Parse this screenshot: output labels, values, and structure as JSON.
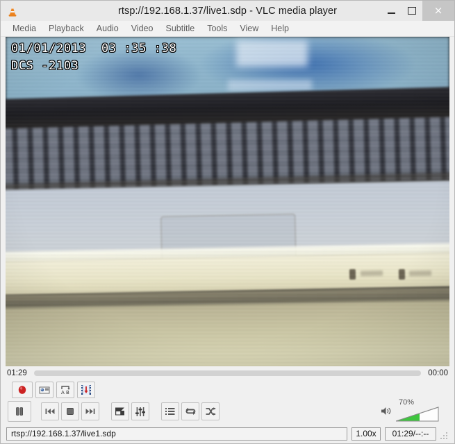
{
  "window": {
    "title": "rtsp://192.168.1.37/live1.sdp - VLC media player",
    "app_icon": "vlc-cone-icon",
    "minimize_label": "",
    "maximize_label": "",
    "close_label": "×"
  },
  "menubar": {
    "items": [
      {
        "label": "Media"
      },
      {
        "label": "Playback"
      },
      {
        "label": "Audio"
      },
      {
        "label": "Video"
      },
      {
        "label": "Subtitle"
      },
      {
        "label": "Tools"
      },
      {
        "label": "View"
      },
      {
        "label": "Help"
      }
    ]
  },
  "video": {
    "osd_line1": "01/01/2013  03 :35 :38",
    "osd_line2": "DCS -2103",
    "description": "blurry webcam view of a laptop keyboard and palm rest"
  },
  "seek": {
    "elapsed": "01:29",
    "remaining": "00:00",
    "progress_percent": 0
  },
  "extended_toolbar": {
    "buttons": [
      {
        "name": "record-button",
        "icon": "record-icon",
        "label": "Record"
      },
      {
        "name": "snapshot-button",
        "icon": "camera-icon",
        "label": "Take snapshot"
      },
      {
        "name": "ab-loop-button",
        "icon": "ab-loop-icon",
        "label": "Loop from A to B"
      },
      {
        "name": "frame-by-frame-button",
        "icon": "film-frame-icon",
        "label": "Frame by frame"
      }
    ]
  },
  "controls": {
    "buttons": [
      {
        "name": "play-pause-button",
        "icon": "pause-icon",
        "label": "Pause"
      },
      {
        "name": "previous-button",
        "icon": "previous-icon",
        "label": "Previous"
      },
      {
        "name": "stop-button",
        "icon": "stop-icon",
        "label": "Stop"
      },
      {
        "name": "next-button",
        "icon": "next-icon",
        "label": "Next"
      },
      {
        "name": "fullscreen-button",
        "icon": "fullscreen-icon",
        "label": "Fullscreen"
      },
      {
        "name": "equalizer-button",
        "icon": "equalizer-icon",
        "label": "Show extended settings"
      },
      {
        "name": "playlist-button",
        "icon": "playlist-icon",
        "label": "Show playlist"
      },
      {
        "name": "loop-button",
        "icon": "loop-icon",
        "label": "Loop"
      },
      {
        "name": "shuffle-button",
        "icon": "shuffle-icon",
        "label": "Random"
      }
    ]
  },
  "volume": {
    "icon": "speaker-icon",
    "percent_label": "70%",
    "percent": 70
  },
  "status": {
    "url": "rtsp://192.168.1.37/live1.sdp",
    "rate": "1.00x",
    "time": "01:29/--:--"
  },
  "colors": {
    "accent_green": "#3ec53e",
    "window_bg": "#f0f0f0",
    "titlebar_bg": "#e9e9e9",
    "close_bg": "#c6c6c6",
    "record_red": "#cc2222"
  }
}
